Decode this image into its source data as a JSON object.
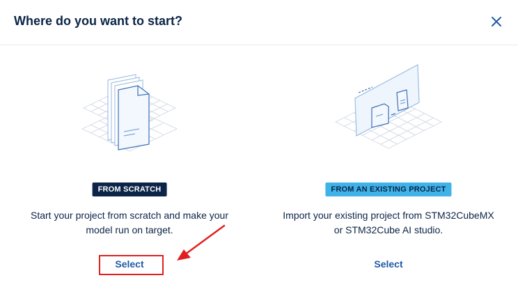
{
  "dialog": {
    "title": "Where do you want to start?",
    "close_icon": "close-icon"
  },
  "options": [
    {
      "badge": "FROM SCRATCH",
      "description_line1": "Start your project from scratch and make your",
      "description_line2": "model run on target.",
      "select_label": "Select",
      "icon": "blank-document-stack-illustration"
    },
    {
      "badge": "FROM AN EXISTING PROJECT",
      "description_line1": "Import your existing project from STM32CubeMX",
      "description_line2": "or STM32Cube AI studio.",
      "select_label": "Select",
      "icon": "import-project-illustration"
    }
  ],
  "annotation": {
    "highlight_color": "#e02020"
  },
  "colors": {
    "navy": "#0b2447",
    "accent_blue": "#3fb3e8",
    "link_blue": "#1f5aa6"
  }
}
